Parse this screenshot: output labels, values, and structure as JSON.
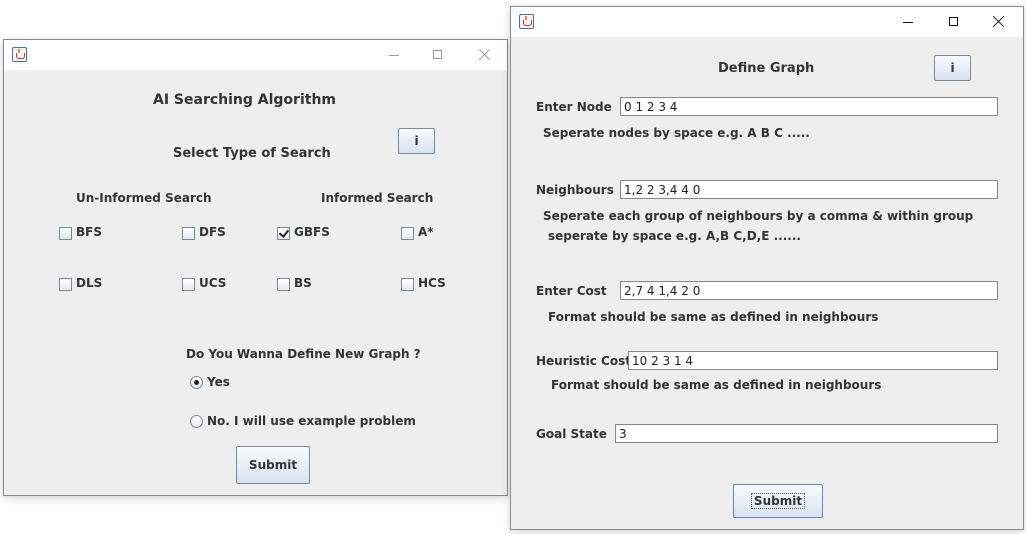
{
  "search_window": {
    "title": "AI Searching Algorithm",
    "subtitle": "Select Type of Search",
    "info_button": "i",
    "uninformed": {
      "heading": "Un-Informed Search",
      "options": [
        {
          "label": "BFS",
          "checked": false
        },
        {
          "label": "DFS",
          "checked": false
        },
        {
          "label": "DLS",
          "checked": false
        },
        {
          "label": "UCS",
          "checked": false
        }
      ]
    },
    "informed": {
      "heading": "Informed Search",
      "options": [
        {
          "label": "GBFS",
          "checked": true
        },
        {
          "label": "A*",
          "checked": false
        },
        {
          "label": "BS",
          "checked": false
        },
        {
          "label": "HCS",
          "checked": false
        }
      ]
    },
    "question": "Do You Wanna Define New Graph ?",
    "radio_yes": {
      "label": "Yes",
      "selected": true
    },
    "radio_no": {
      "label": "No. I will use example problem",
      "selected": false
    },
    "submit": "Submit"
  },
  "graph_window": {
    "title": "Define Graph",
    "info_button": "i",
    "node": {
      "label": "Enter Node",
      "value": "0 1 2 3 4",
      "hint": "Seperate nodes by space e.g. A B C ....."
    },
    "neighbours": {
      "label": "Neighbours",
      "value": "1,2 2 3,4 4 0",
      "hint_line1": "Seperate each group of neighbours by a comma & within group",
      "hint_line2": "seperate by space e.g. A,B C,D,E ......"
    },
    "cost": {
      "label": "Enter Cost",
      "value": "2,7 4 1,4 2 0",
      "hint": "Format should be same as defined in neighbours"
    },
    "heuristic": {
      "label": "Heuristic Cost",
      "value": "10 2 3 1 4",
      "hint": "Format should be same as defined in neighbours"
    },
    "goal": {
      "label": "Goal State",
      "value": "3"
    },
    "submit": "Submit"
  },
  "colors": {
    "window_bg": "#eeeeee",
    "titlebar_bg": "#ffffff",
    "button_gradient_top": "#f8fbff",
    "button_gradient_bottom": "#d7e3ef",
    "text": "#333333"
  },
  "icons": [
    "java-app-icon",
    "minimize-icon",
    "maximize-icon",
    "close-icon",
    "check-icon",
    "radio-dot-icon"
  ]
}
